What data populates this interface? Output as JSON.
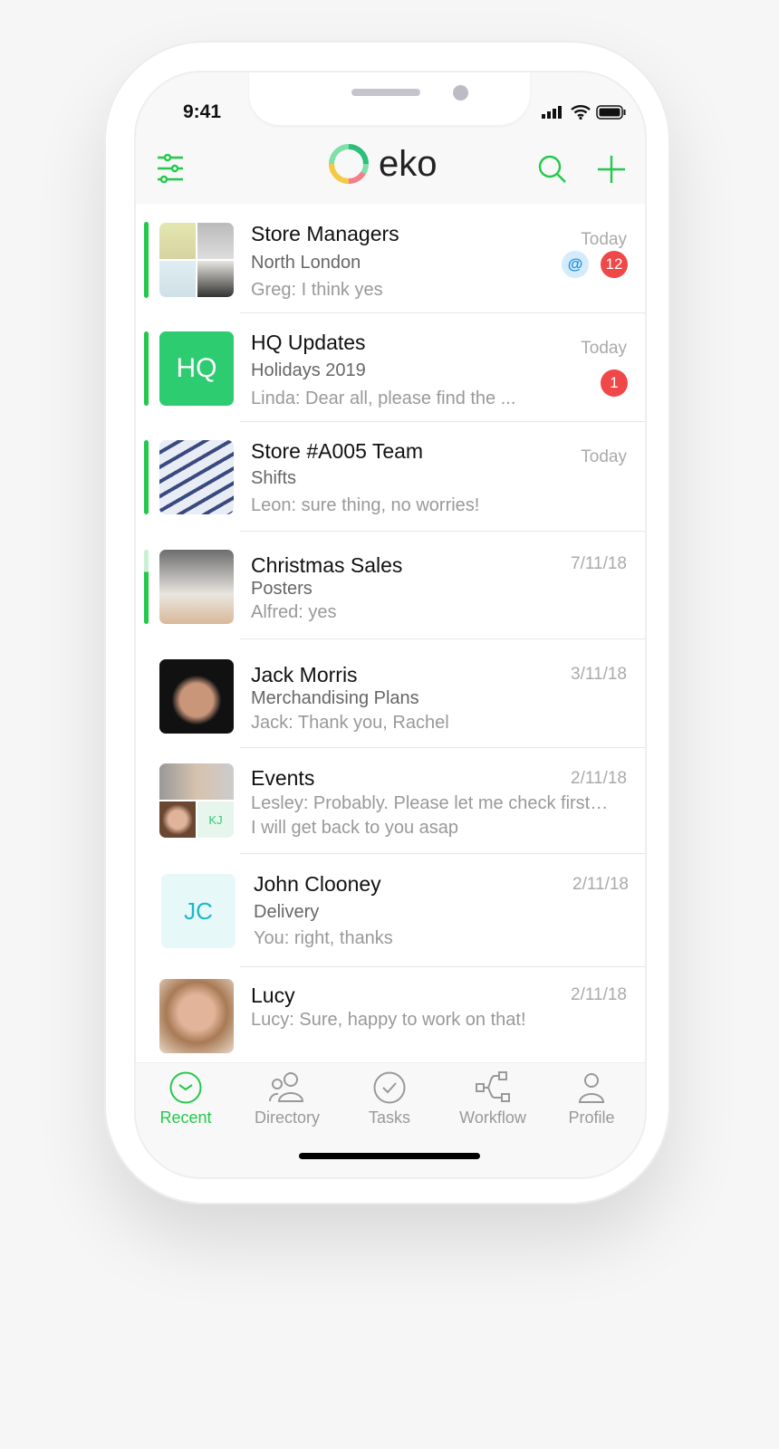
{
  "status_bar": {
    "time": "9:41"
  },
  "header": {
    "logo_text": "eko",
    "filter_icon": "sliders-icon",
    "search_icon": "search-icon",
    "add_icon": "plus-icon"
  },
  "accent": "#22c94a",
  "chats": [
    {
      "title": "Store Managers",
      "subtitle": "North London",
      "preview": "Greg: I think yes",
      "date": "Today",
      "mention": "@",
      "unread": "12",
      "active": true
    },
    {
      "title": "HQ Updates",
      "subtitle": "Holidays 2019",
      "preview": "Linda: Dear all, please find the ...",
      "date": "Today",
      "avatar_text": "HQ",
      "unread": "1",
      "active": true
    },
    {
      "title": "Store #A005 Team",
      "subtitle": "Shifts",
      "preview": "Leon: sure thing, no worries!",
      "date": "Today",
      "active": true
    },
    {
      "title": "Christmas Sales",
      "subtitle": "Posters",
      "preview": "Alfred: yes",
      "date": "7/11/18",
      "active": true
    },
    {
      "title": "Jack Morris",
      "subtitle": "Merchandising Plans",
      "preview": "Jack: Thank you, Rachel",
      "date": "3/11/18"
    },
    {
      "title": "Events",
      "subtitle": "Lesley: Probably. Please let me check first…",
      "preview": "I will get back to you asap",
      "date": "2/11/18",
      "avatar_text": "KJ"
    },
    {
      "title": "John Clooney",
      "subtitle": "Delivery",
      "preview": "You: right, thanks",
      "date": "2/11/18",
      "avatar_text": "JC"
    },
    {
      "title": "Lucy",
      "subtitle": "Lucy: Sure, happy to work on that!",
      "date": "2/11/18"
    }
  ],
  "tabs": [
    {
      "label": "Recent",
      "icon": "clock-icon",
      "active": true
    },
    {
      "label": "Directory",
      "icon": "people-icon"
    },
    {
      "label": "Tasks",
      "icon": "check-circle-icon"
    },
    {
      "label": "Workflow",
      "icon": "workflow-icon"
    },
    {
      "label": "Profile",
      "icon": "person-icon"
    }
  ]
}
